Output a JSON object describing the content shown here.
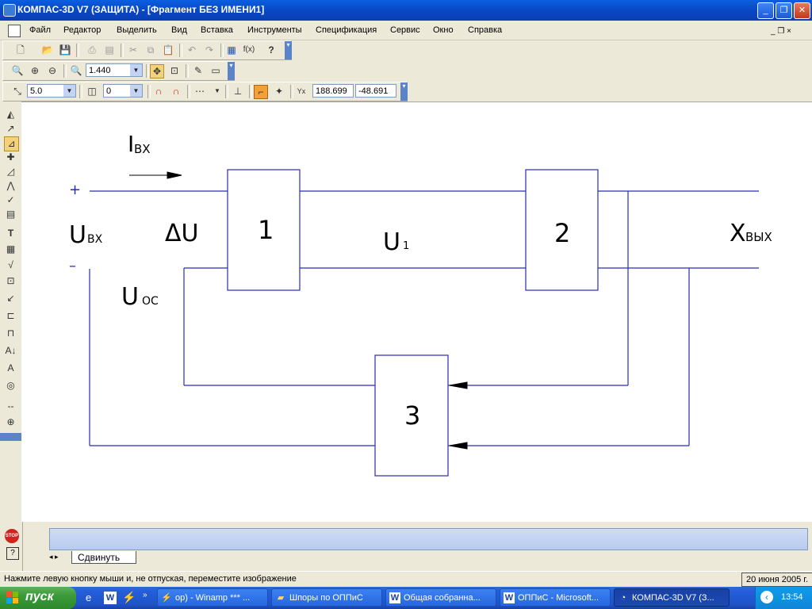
{
  "window": {
    "title": "КОМПАС-3D V7 (ЗАЩИТА) - [Фрагмент БЕЗ ИМЕНИ1]",
    "min_glyph": "_",
    "restore_glyph": "❐",
    "close_glyph": "✕"
  },
  "menu": {
    "items": [
      "Файл",
      "Редактор",
      "Выделить",
      "Вид",
      "Вставка",
      "Инструменты",
      "Спецификация",
      "Сервис",
      "Окно",
      "Справка"
    ],
    "mdi_controls": "_ ❐ ×"
  },
  "toolbar_view": {
    "zoom_value": "1.440"
  },
  "toolbar_props": {
    "step_value": "5.0",
    "layer_value": "0",
    "coord_x": "188.699",
    "coord_y": "-48.691"
  },
  "diagram": {
    "input_current_label": "I",
    "input_current_sub": "ВХ",
    "plus_sign": "+",
    "minus_sign": "–",
    "input_voltage_label": "U",
    "input_voltage_sub": "ВХ",
    "delta_u_label": "ΔU",
    "feedback_label": "U",
    "feedback_sub": "ОС",
    "mid_signal_label": "U",
    "mid_signal_sub": "1",
    "output_label": "X",
    "output_sub": "ВЫХ",
    "block1": "1",
    "block2": "2",
    "block3": "3"
  },
  "bottom": {
    "tab_label": "Сдвинуть",
    "stop_label": "STOP"
  },
  "status": {
    "hint": "Нажмите левую кнопку мыши и, не отпуская, переместите изображение",
    "date": "20 июня 2005 г."
  },
  "taskbar": {
    "start_label": "пуск",
    "tasks": [
      "op) - Winamp *** ...",
      "Шпоры по ОППиС",
      "Общая собранна...",
      "ОППиС - Microsoft...",
      "КОМПАС-3D V7 (З..."
    ],
    "clock": "13:54"
  }
}
